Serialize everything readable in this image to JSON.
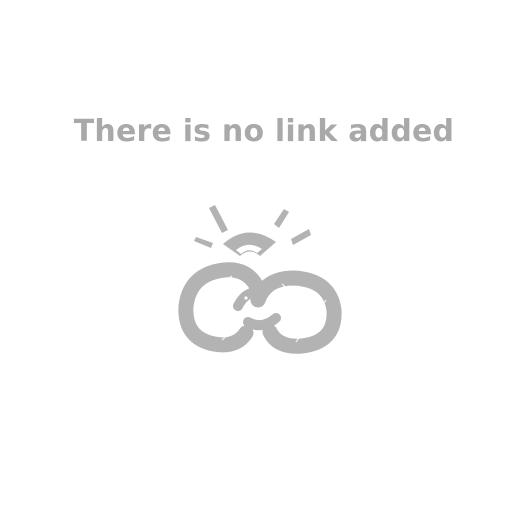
{
  "empty_state": {
    "message": "There is no link added",
    "illustration_icon": "broken-chain-link-icon"
  },
  "colors": {
    "text": "#a9a9a9",
    "illustration_stroke": "#b3b3b3",
    "illustration_fill": "#b3b3b3",
    "background": "#ffffff"
  }
}
